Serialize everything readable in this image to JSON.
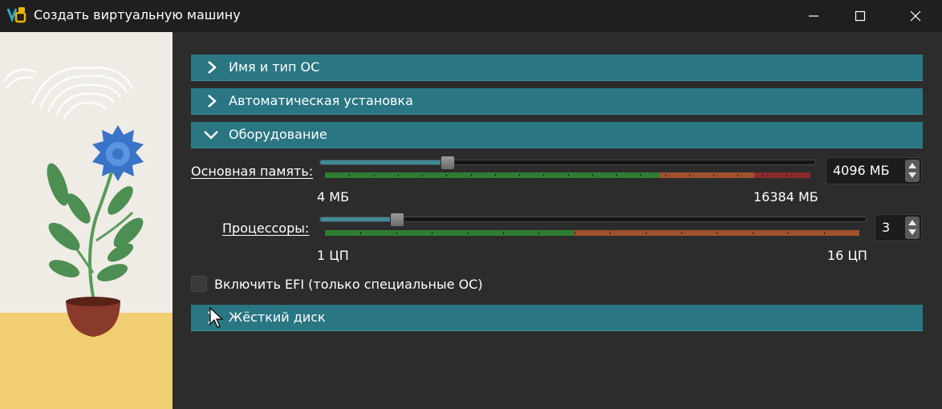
{
  "window": {
    "title": "Создать виртуальную машину"
  },
  "sections": [
    {
      "label": "Имя и тип ОС",
      "underline": "т",
      "pre": "Имя и ",
      "post": "ип ОС",
      "state": "collapsed"
    },
    {
      "label": "Автоматическая установка",
      "state": "collapsed"
    },
    {
      "label": "Оборудование",
      "state": "expanded"
    },
    {
      "label": "Жёсткий диск",
      "state": "collapsed"
    }
  ],
  "hardware": {
    "memory": {
      "label": "Основная память:",
      "value": "4096 МБ",
      "min_label": "4 МБ",
      "max_label": "16384 МБ",
      "fraction": 0.25
    },
    "cpu": {
      "label": "Процессоры:",
      "value": "3",
      "min_label": "1 ЦП",
      "max_label": "16 ЦП",
      "fraction": 0.133
    },
    "efi": {
      "label": "Включить EFI (только специальные ОС)",
      "checked": false
    }
  },
  "colors": {
    "accent": "#2a7683",
    "scale_green": "#2e7d32",
    "scale_orange": "#a0522d",
    "scale_red": "#8b2a2a"
  }
}
